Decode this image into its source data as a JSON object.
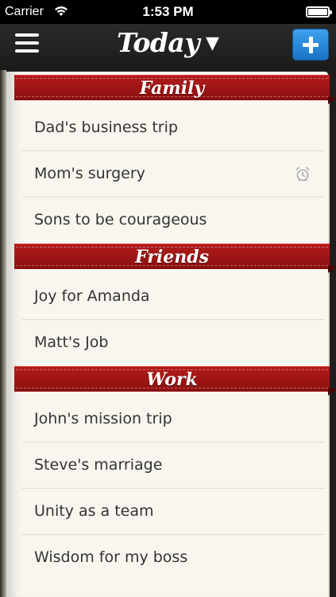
{
  "status_bar": {
    "carrier": "Carrier",
    "time": "1:53 PM",
    "wifi_icon": "wifi-icon",
    "battery_icon": "battery-icon"
  },
  "nav": {
    "title": "Today",
    "caret": "▼",
    "menu_icon": "hamburger-menu-icon",
    "add_icon": "plus-icon",
    "accent": "#2a86dc"
  },
  "ribbon_color": "#a31616",
  "sections": [
    {
      "title": "Family",
      "items": [
        {
          "label": "Dad's business trip",
          "alarm": false
        },
        {
          "label": "Mom's surgery",
          "alarm": true
        },
        {
          "label": "Sons to be courageous",
          "alarm": false
        }
      ]
    },
    {
      "title": "Friends",
      "items": [
        {
          "label": "Joy for Amanda",
          "alarm": false
        },
        {
          "label": "Matt's Job",
          "alarm": false
        }
      ]
    },
    {
      "title": "Work",
      "items": [
        {
          "label": "John's mission trip",
          "alarm": false
        },
        {
          "label": "Steve's marriage",
          "alarm": false
        },
        {
          "label": "Unity as a team",
          "alarm": false
        },
        {
          "label": "Wisdom for my boss",
          "alarm": false
        }
      ]
    }
  ]
}
